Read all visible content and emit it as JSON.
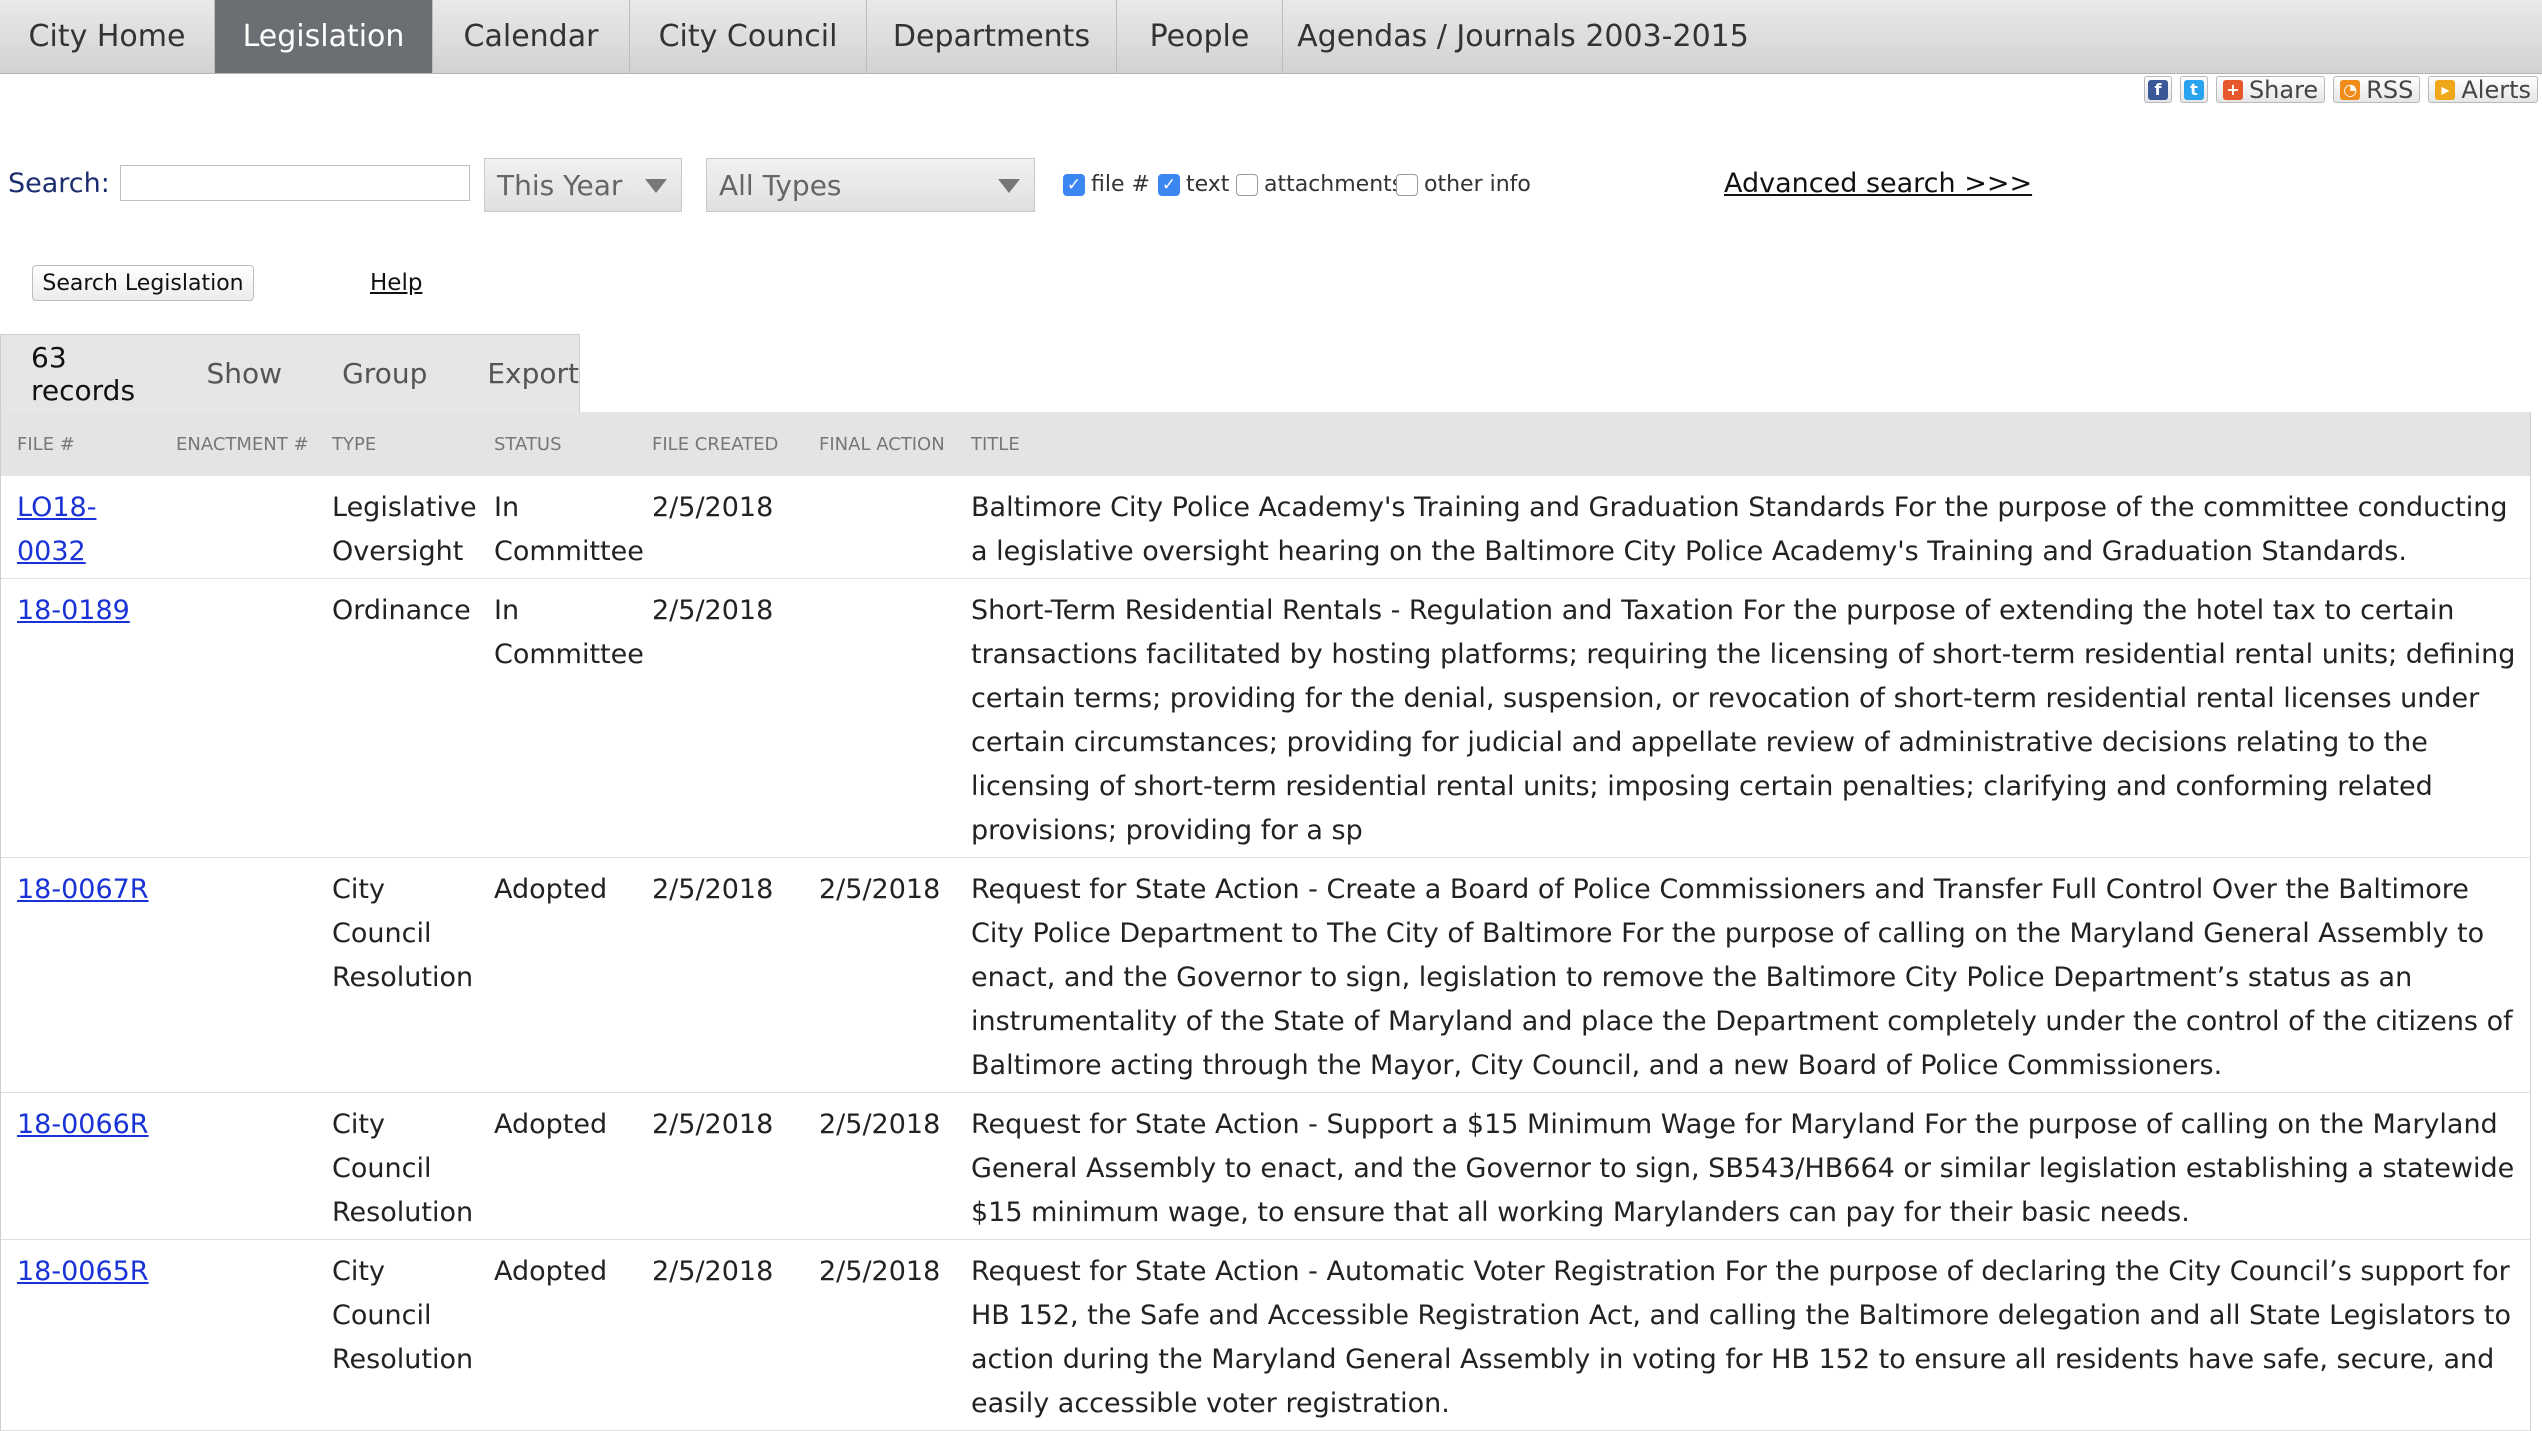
{
  "nav": {
    "tabs": [
      {
        "label": "City Home"
      },
      {
        "label": "Legislation"
      },
      {
        "label": "Calendar"
      },
      {
        "label": "City Council"
      },
      {
        "label": "Departments"
      },
      {
        "label": "People"
      },
      {
        "label": "Agendas / Journals 2003-2015"
      }
    ],
    "active_tab": "Legislation"
  },
  "share": {
    "facebook_icon": "f",
    "twitter_icon": "t",
    "share_label": "Share",
    "rss_label": "RSS",
    "alerts_label": "Alerts"
  },
  "search": {
    "label": "Search:",
    "input_value": "",
    "year_select": "This Year",
    "type_select": "All Types",
    "options": [
      {
        "label": "file #",
        "checked": true
      },
      {
        "label": "text",
        "checked": true
      },
      {
        "label": "attachments",
        "checked": false
      },
      {
        "label": "other info",
        "checked": false
      }
    ],
    "advanced_link": "Advanced search >>>",
    "search_button": "Search Legislation",
    "help_link": "Help"
  },
  "toolbar": {
    "records": "63 records",
    "show": "Show",
    "group": "Group",
    "export": "Export"
  },
  "table": {
    "headers": [
      "File #",
      "Enactment #",
      "Type",
      "Status",
      "File Created",
      "Final Action",
      "Title"
    ],
    "rows": [
      {
        "file": "LO18-0032",
        "enactment": "",
        "type": "Legislative Oversight",
        "status": "In Committee",
        "created": "2/5/2018",
        "final": "",
        "title": "Baltimore City Police Academy's Training and Graduation Standards For the purpose of the committee conducting a legislative oversight hearing on the Baltimore City Police Academy's Training and Graduation Standards."
      },
      {
        "file": "18-0189",
        "enactment": "",
        "type": "Ordinance",
        "status": "In Committee",
        "created": "2/5/2018",
        "final": "",
        "title": "Short-Term Residential Rentals - Regulation and Taxation For the purpose of extending the hotel tax to certain transactions facilitated by hosting platforms; requiring the licensing of short-term residential rental units; defining certain terms; providing for the denial, suspension, or revocation of short-term residential rental licenses under certain circumstances; providing for judicial and appellate review of administrative decisions relating to the licensing of short-term residential rental units; imposing certain penalties; clarifying and conforming related provisions; providing for a sp"
      },
      {
        "file": "18-0067R",
        "enactment": "",
        "type": "City Council Resolution",
        "status": "Adopted",
        "created": "2/5/2018",
        "final": "2/5/2018",
        "title": "Request for State Action - Create a Board of Police Commissioners and Transfer Full Control Over the Baltimore City Police Department to The City of Baltimore For the purpose of calling on the Maryland General Assembly to enact, and the Governor to sign, legislation to remove the Baltimore City Police Department’s status as an instrumentality of the State of Maryland and place the Department completely under the control of the citizens of Baltimore acting through the Mayor, City Council, and a new Board of Police Commissioners."
      },
      {
        "file": "18-0066R",
        "enactment": "",
        "type": "City Council Resolution",
        "status": "Adopted",
        "created": "2/5/2018",
        "final": "2/5/2018",
        "title": "Request for State Action - Support a $15 Minimum Wage for Maryland For the purpose of calling on the Maryland General Assembly to enact, and the Governor to sign, SB543/HB664 or similar legislation establishing a statewide $15 minimum wage, to ensure that all working Marylanders can pay for their basic needs."
      },
      {
        "file": "18-0065R",
        "enactment": "",
        "type": "City Council Resolution",
        "status": "Adopted",
        "created": "2/5/2018",
        "final": "2/5/2018",
        "title": "Request for State Action - Automatic Voter Registration For the purpose of declaring the City Council’s support for HB 152, the Safe and Accessible Registration Act, and calling the Baltimore delegation and all State Legislators to action during the Maryland General Assembly in voting for HB 152 to ensure all residents have safe, secure, and easily accessible voter registration."
      }
    ]
  }
}
